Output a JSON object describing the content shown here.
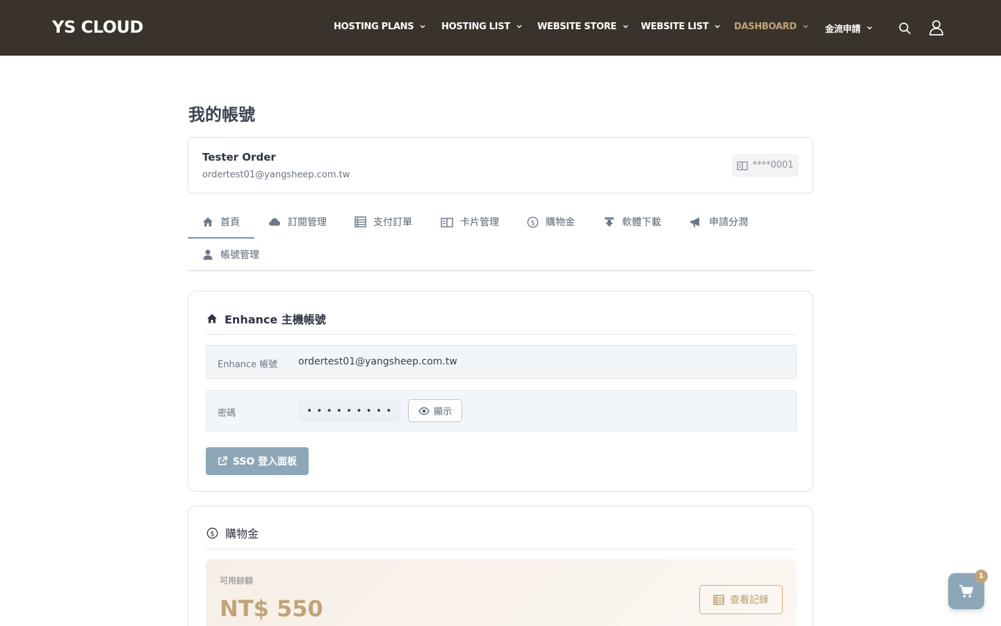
{
  "header": {
    "logo": "YS CLOUD",
    "nav": [
      {
        "label": "HOSTING PLANS"
      },
      {
        "label": "HOSTING LIST"
      },
      {
        "label": "WEBSITE STORE"
      },
      {
        "label": "WEBSITE LIST"
      },
      {
        "label": "DASHBOARD",
        "active": true
      },
      {
        "label": "金流申請"
      }
    ],
    "icons": [
      "search-icon",
      "user-icon"
    ]
  },
  "page": {
    "title": "我的帳號"
  },
  "profile": {
    "name": "Tester Order",
    "email": "ordertest01@yangsheep.com.tw",
    "card_badge": "****0001"
  },
  "tabs": [
    {
      "label": "首頁",
      "icon": "home-icon",
      "active": true
    },
    {
      "label": "訂閱管理",
      "icon": "cloud-icon"
    },
    {
      "label": "支付訂單",
      "icon": "list-icon"
    },
    {
      "label": "卡片管理",
      "icon": "card-icon"
    },
    {
      "label": "購物金",
      "icon": "dollar-icon"
    },
    {
      "label": "軟體下載",
      "icon": "download-icon"
    },
    {
      "label": "申請分潤",
      "icon": "megaphone-icon"
    },
    {
      "label": "帳號管理",
      "icon": "user-icon"
    }
  ],
  "enhance": {
    "title": "Enhance 主機帳號",
    "account_label": "Enhance 帳號",
    "account_value": "ordertest01@yangsheep.com.tw",
    "password_label": "密碼",
    "password_mask": "•••••••••",
    "show_label": "顯示",
    "sso_label": "SSO 登入面板"
  },
  "credit": {
    "title": "購物金",
    "balance_label": "可用餘額",
    "balance": "NT$ 550",
    "history_label": "查看記錄"
  },
  "cart": {
    "count": "1"
  },
  "colors": {
    "header_bg": "#3a332b",
    "accent_gold": "#c0a37a",
    "accent_slate": "#8ea7b8"
  }
}
